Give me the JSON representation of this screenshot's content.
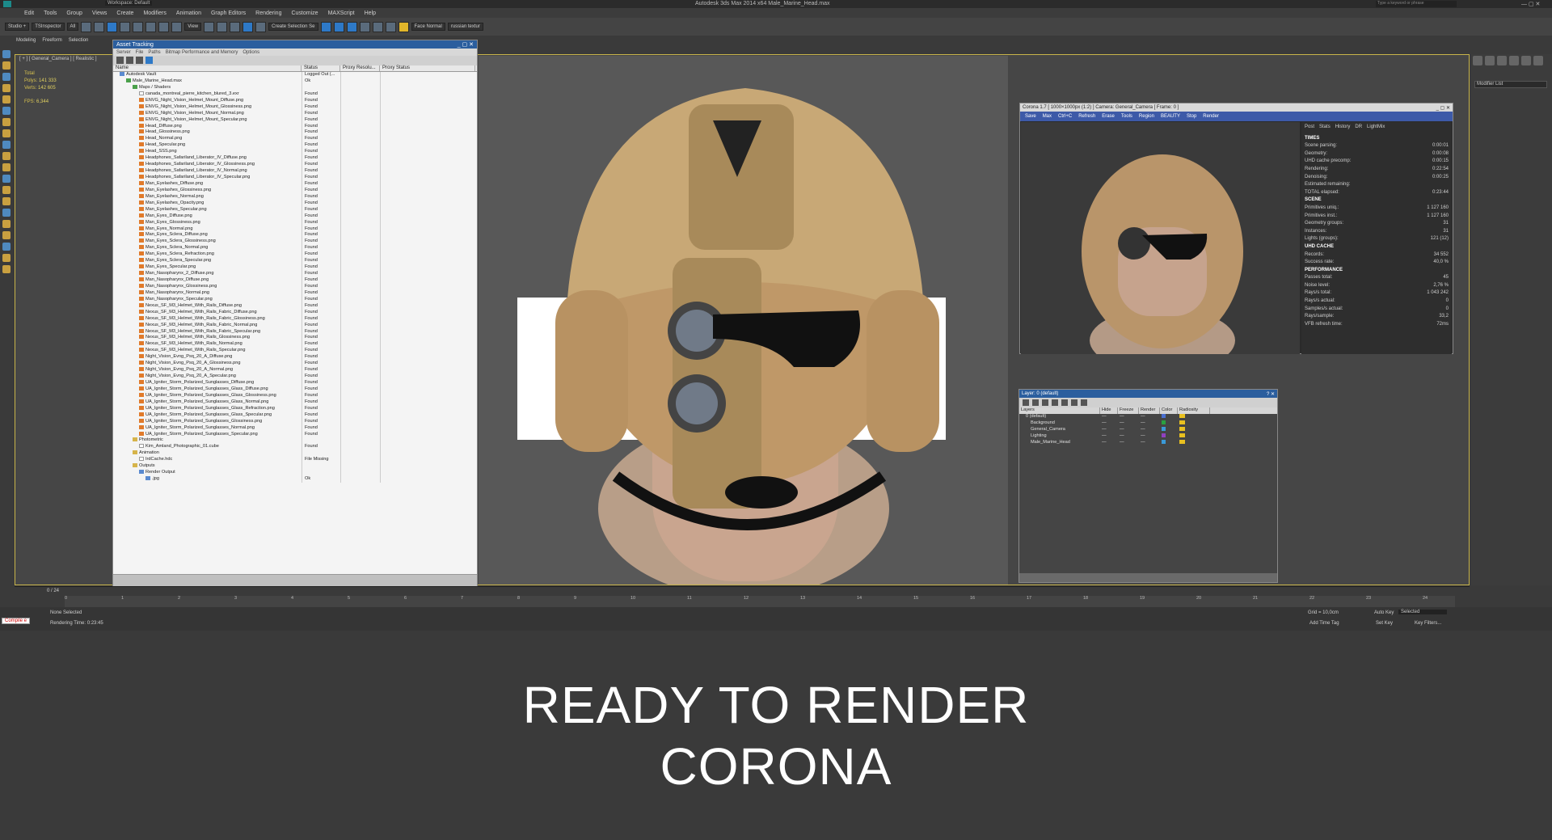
{
  "app": {
    "title": "Autodesk 3ds Max 2014 x64    Male_Marine_Head.max",
    "workspace": "Workspace: Default",
    "search_placeholder": "Type a keyword or phrase"
  },
  "menu": [
    "Edit",
    "Tools",
    "Group",
    "Views",
    "Create",
    "Modifiers",
    "Animation",
    "Graph Editors",
    "Rendering",
    "Customize",
    "MAXScript",
    "Help"
  ],
  "toolbar": {
    "studio_label": "Studio +",
    "inspector_label": "TSInspector",
    "filter_label": "All",
    "view_label": "View",
    "selection_set": "Create Selection Se",
    "face_normal": "Face Normal",
    "russian_texture": "russian textur"
  },
  "ribbon": [
    "Modeling",
    "Freeform",
    "Selection"
  ],
  "viewport": {
    "label": "[ + ] [ General_Camera ] [ Realistic ]",
    "stats": {
      "total_label": "Total",
      "polys_label": "Polys:",
      "polys": "141 333",
      "verts_label": "Verts:",
      "verts": "142 605",
      "fps_label": "FPS:",
      "fps": "6,344"
    }
  },
  "asset_tracking": {
    "title": "Asset Tracking",
    "menu": [
      "Server",
      "File",
      "Paths",
      "Bitmap Performance and Memory",
      "Options"
    ],
    "columns": [
      "Name",
      "Status",
      "Proxy Resolu...",
      "Proxy Status"
    ],
    "rows": [
      {
        "name": "Autodesk Vault",
        "status": "Logged Out (...",
        "indent": 1,
        "icon": "b"
      },
      {
        "name": "Male_Marine_Head.max",
        "status": "Ok",
        "indent": 2,
        "icon": "g"
      },
      {
        "name": "Maps / Shaders",
        "status": "",
        "indent": 3,
        "icon": "g"
      },
      {
        "name": "canada_montreal_pierre_kitchen_blured_3.exr",
        "status": "Found",
        "indent": 4,
        "icon": "w"
      },
      {
        "name": "ENVG_Night_Vision_Helmet_Mount_Diffuse.png",
        "status": "Found",
        "indent": 4,
        "icon": "o"
      },
      {
        "name": "ENVG_Night_Vision_Helmet_Mount_Glossiness.png",
        "status": "Found",
        "indent": 4,
        "icon": "o"
      },
      {
        "name": "ENVG_Night_Vision_Helmet_Mount_Normal.png",
        "status": "Found",
        "indent": 4,
        "icon": "o"
      },
      {
        "name": "ENVG_Night_Vision_Helmet_Mount_Specular.png",
        "status": "Found",
        "indent": 4,
        "icon": "o"
      },
      {
        "name": "Head_Diffuse.png",
        "status": "Found",
        "indent": 4,
        "icon": "o"
      },
      {
        "name": "Head_Glossiness.png",
        "status": "Found",
        "indent": 4,
        "icon": "o"
      },
      {
        "name": "Head_Normal.png",
        "status": "Found",
        "indent": 4,
        "icon": "o"
      },
      {
        "name": "Head_Specular.png",
        "status": "Found",
        "indent": 4,
        "icon": "o"
      },
      {
        "name": "Head_SSS.png",
        "status": "Found",
        "indent": 4,
        "icon": "o"
      },
      {
        "name": "Headphones_Safariland_Liberator_IV_Diffuse.png",
        "status": "Found",
        "indent": 4,
        "icon": "o"
      },
      {
        "name": "Headphones_Safariland_Liberator_IV_Glossiness.png",
        "status": "Found",
        "indent": 4,
        "icon": "o"
      },
      {
        "name": "Headphones_Safariland_Liberator_IV_Normal.png",
        "status": "Found",
        "indent": 4,
        "icon": "o"
      },
      {
        "name": "Headphones_Safariland_Liberator_IV_Specular.png",
        "status": "Found",
        "indent": 4,
        "icon": "o"
      },
      {
        "name": "Man_Eyelashes_Diffuse.png",
        "status": "Found",
        "indent": 4,
        "icon": "o"
      },
      {
        "name": "Man_Eyelashes_Glossiness.png",
        "status": "Found",
        "indent": 4,
        "icon": "o"
      },
      {
        "name": "Man_Eyelashes_Normal.png",
        "status": "Found",
        "indent": 4,
        "icon": "o"
      },
      {
        "name": "Man_Eyelashes_Opacity.png",
        "status": "Found",
        "indent": 4,
        "icon": "o"
      },
      {
        "name": "Man_Eyelashes_Specular.png",
        "status": "Found",
        "indent": 4,
        "icon": "o"
      },
      {
        "name": "Man_Eyes_Diffuse.png",
        "status": "Found",
        "indent": 4,
        "icon": "o"
      },
      {
        "name": "Man_Eyes_Glossiness.png",
        "status": "Found",
        "indent": 4,
        "icon": "o"
      },
      {
        "name": "Man_Eyes_Normal.png",
        "status": "Found",
        "indent": 4,
        "icon": "o"
      },
      {
        "name": "Man_Eyes_Sclera_Diffuse.png",
        "status": "Found",
        "indent": 4,
        "icon": "o"
      },
      {
        "name": "Man_Eyes_Sclera_Glossiness.png",
        "status": "Found",
        "indent": 4,
        "icon": "o"
      },
      {
        "name": "Man_Eyes_Sclera_Normal.png",
        "status": "Found",
        "indent": 4,
        "icon": "o"
      },
      {
        "name": "Man_Eyes_Sclera_Refraction.png",
        "status": "Found",
        "indent": 4,
        "icon": "o"
      },
      {
        "name": "Man_Eyes_Sclera_Specular.png",
        "status": "Found",
        "indent": 4,
        "icon": "o"
      },
      {
        "name": "Man_Eyes_Specular.png",
        "status": "Found",
        "indent": 4,
        "icon": "o"
      },
      {
        "name": "Man_Nasopharynx_2_Diffuse.png",
        "status": "Found",
        "indent": 4,
        "icon": "o"
      },
      {
        "name": "Man_Nasopharynx_Diffuse.png",
        "status": "Found",
        "indent": 4,
        "icon": "o"
      },
      {
        "name": "Man_Nasopharynx_Glossiness.png",
        "status": "Found",
        "indent": 4,
        "icon": "o"
      },
      {
        "name": "Man_Nasopharynx_Normal.png",
        "status": "Found",
        "indent": 4,
        "icon": "o"
      },
      {
        "name": "Man_Nasopharynx_Specular.png",
        "status": "Found",
        "indent": 4,
        "icon": "o"
      },
      {
        "name": "Nexus_SF_M3_Helmet_With_Rails_Diffuse.png",
        "status": "Found",
        "indent": 4,
        "icon": "o"
      },
      {
        "name": "Nexus_SF_M3_Helmet_With_Rails_Fabric_Diffuse.png",
        "status": "Found",
        "indent": 4,
        "icon": "o"
      },
      {
        "name": "Nexus_SF_M3_Helmet_With_Rails_Fabric_Glossiness.png",
        "status": "Found",
        "indent": 4,
        "icon": "o"
      },
      {
        "name": "Nexus_SF_M3_Helmet_With_Rails_Fabric_Normal.png",
        "status": "Found",
        "indent": 4,
        "icon": "o"
      },
      {
        "name": "Nexus_SF_M3_Helmet_With_Rails_Fabric_Specular.png",
        "status": "Found",
        "indent": 4,
        "icon": "o"
      },
      {
        "name": "Nexus_SF_M3_Helmet_With_Rails_Glossiness.png",
        "status": "Found",
        "indent": 4,
        "icon": "o"
      },
      {
        "name": "Nexus_SF_M3_Helmet_With_Rails_Normal.png",
        "status": "Found",
        "indent": 4,
        "icon": "o"
      },
      {
        "name": "Nexus_SF_M3_Helmet_With_Rails_Specular.png",
        "status": "Found",
        "indent": 4,
        "icon": "o"
      },
      {
        "name": "Night_Vision_Evng_Psq_20_A_Diffuse.png",
        "status": "Found",
        "indent": 4,
        "icon": "o"
      },
      {
        "name": "Night_Vision_Evng_Psq_20_A_Glossiness.png",
        "status": "Found",
        "indent": 4,
        "icon": "o"
      },
      {
        "name": "Night_Vision_Evng_Psq_20_A_Normal.png",
        "status": "Found",
        "indent": 4,
        "icon": "o"
      },
      {
        "name": "Night_Vision_Evng_Psq_20_A_Specular.png",
        "status": "Found",
        "indent": 4,
        "icon": "o"
      },
      {
        "name": "UA_Igniter_Storm_Polarized_Sunglasses_Diffuse.png",
        "status": "Found",
        "indent": 4,
        "icon": "o"
      },
      {
        "name": "UA_Igniter_Storm_Polarized_Sunglasses_Glass_Diffuse.png",
        "status": "Found",
        "indent": 4,
        "icon": "o"
      },
      {
        "name": "UA_Igniter_Storm_Polarized_Sunglasses_Glass_Glossiness.png",
        "status": "Found",
        "indent": 4,
        "icon": "o"
      },
      {
        "name": "UA_Igniter_Storm_Polarized_Sunglasses_Glass_Normal.png",
        "status": "Found",
        "indent": 4,
        "icon": "o"
      },
      {
        "name": "UA_Igniter_Storm_Polarized_Sunglasses_Glass_Refraction.png",
        "status": "Found",
        "indent": 4,
        "icon": "o"
      },
      {
        "name": "UA_Igniter_Storm_Polarized_Sunglasses_Glass_Specular.png",
        "status": "Found",
        "indent": 4,
        "icon": "o"
      },
      {
        "name": "UA_Igniter_Storm_Polarized_Sunglasses_Glossiness.png",
        "status": "Found",
        "indent": 4,
        "icon": "o"
      },
      {
        "name": "UA_Igniter_Storm_Polarized_Sunglasses_Normal.png",
        "status": "Found",
        "indent": 4,
        "icon": "o"
      },
      {
        "name": "UA_Igniter_Storm_Polarized_Sunglasses_Specular.png",
        "status": "Found",
        "indent": 4,
        "icon": "o"
      },
      {
        "name": "Photometric",
        "status": "",
        "indent": 3,
        "icon": "y"
      },
      {
        "name": "Kim_Amland_Photographic_01.cube",
        "status": "Found",
        "indent": 4,
        "icon": "w"
      },
      {
        "name": "Animation",
        "status": "",
        "indent": 3,
        "icon": "y"
      },
      {
        "name": "IrdCache.hdc",
        "status": "File Missing",
        "indent": 4,
        "icon": "w"
      },
      {
        "name": "Outputs",
        "status": "",
        "indent": 3,
        "icon": "y"
      },
      {
        "name": "Render Output",
        "status": "",
        "indent": 4,
        "icon": "b"
      },
      {
        "name": ".jpg",
        "status": "Ok",
        "indent": 5,
        "icon": "b"
      }
    ]
  },
  "corona_vfb": {
    "title": "Corona 1.7 [ 1000×1000px (1:2) ] Camera: General_Camera [ Frame: 0 ]",
    "toolbar": [
      "Save",
      "Max",
      "Ctrl+C",
      "Refresh",
      "Erase",
      "Tools",
      "Region",
      "BEAUTY",
      "Stop",
      "Render"
    ],
    "tabs": [
      "Post",
      "Stats",
      "History",
      "DR",
      "LightMix"
    ],
    "sections": [
      {
        "title": "TIMES",
        "lines": [
          [
            "Scene parsing:",
            "0:00:01"
          ],
          [
            "Geometry:",
            "0:00:08"
          ],
          [
            "UHD cache precomp:",
            "0:00:15"
          ],
          [
            "Rendering:",
            "0:22:54"
          ],
          [
            "Denoising:",
            "0:00:25"
          ],
          [
            "Estimated remaining:",
            ""
          ],
          [
            "TOTAL elapsed:",
            "0:23:44"
          ]
        ]
      },
      {
        "title": "SCENE",
        "lines": [
          [
            "Primitives uniq.:",
            "1 127 160"
          ],
          [
            "Primitives inst.:",
            "1 127 160"
          ],
          [
            "Geometry groups:",
            "31"
          ],
          [
            "Instances:",
            "31"
          ],
          [
            "Lights (groups):",
            "121 (12)"
          ]
        ]
      },
      {
        "title": "UHD CACHE",
        "lines": [
          [
            "Records:",
            "34 552"
          ],
          [
            "Success rate:",
            "40,0 %"
          ]
        ]
      },
      {
        "title": "PERFORMANCE",
        "lines": [
          [
            "Passes total:",
            "45"
          ],
          [
            "Noise level:",
            "2,76 %"
          ],
          [
            "Rays/s total:",
            "1 043 242"
          ],
          [
            "Rays/s actual:",
            "0"
          ],
          [
            "Samples/s actual:",
            "0"
          ],
          [
            "Rays/sample:",
            "33,2"
          ],
          [
            "VFB refresh time:",
            "72ms"
          ]
        ]
      }
    ]
  },
  "layer_dialog": {
    "title": "Layer: 0 (default)",
    "columns": [
      "Layers",
      "Hide",
      "Freeze",
      "Render",
      "Color",
      "Radiosity"
    ],
    "rows": [
      "0 (default)",
      "Background",
      "General_Camera",
      "Lighting",
      "Male_Marine_Head"
    ],
    "row_colors": [
      "#4a6fd0",
      "#2aa040",
      "#3a9ad8",
      "#9040c0",
      "#3a9ad8"
    ]
  },
  "right_panel": {
    "modifier_list": "Modifier List"
  },
  "timeline": {
    "frame": "0 / 24",
    "ticks": [
      "0",
      "1",
      "2",
      "3",
      "4",
      "5",
      "6",
      "7",
      "8",
      "9",
      "10",
      "11",
      "12",
      "13",
      "14",
      "15",
      "16",
      "17",
      "18",
      "19",
      "20",
      "21",
      "22",
      "23",
      "24"
    ]
  },
  "status_bar": {
    "selection": "None Selected",
    "render_time": "Rendering Time: 0:23:45",
    "compile": "Compile e",
    "grid": "Grid = 10,0cm",
    "auto_key": "Auto Key",
    "selected": "Selected",
    "set_key": "Set Key",
    "key_filters": "Key Filters...",
    "add_time_tag": "Add Time Tag"
  },
  "caption": {
    "line1": "READY TO RENDER",
    "line2": "CORONA"
  }
}
